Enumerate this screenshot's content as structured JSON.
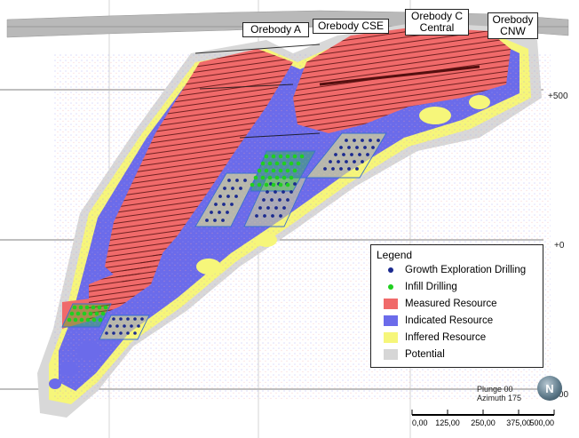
{
  "orebodies": {
    "a": "Orebody A",
    "cse": "Orebody CSE",
    "c_central": "Orebody C\nCentral",
    "cnw": "Orebody\nCNW"
  },
  "elevations": [
    "+500",
    "+0",
    "-500"
  ],
  "legend": {
    "title": "Legend",
    "items": [
      {
        "label": "Growth Exploration Drilling",
        "color": "#1b2a8f",
        "kind": "dot"
      },
      {
        "label": "Infill Drilling",
        "color": "#1fcf1f",
        "kind": "dot"
      },
      {
        "label": "Measured Resource",
        "color": "#f06a6a",
        "kind": "box"
      },
      {
        "label": "Indicated Resource",
        "color": "#6b6bea",
        "kind": "box"
      },
      {
        "label": "Inffered Resource",
        "color": "#f6f67a",
        "kind": "box"
      },
      {
        "label": "Potential",
        "color": "#d6d6d6",
        "kind": "box"
      }
    ]
  },
  "view": {
    "plunge": "Plunge 00",
    "azimuth": "Azimuth 175"
  },
  "scale_ticks": [
    "0,00",
    "125,00",
    "250,00",
    "375,00",
    "500,00"
  ],
  "compass": "N"
}
